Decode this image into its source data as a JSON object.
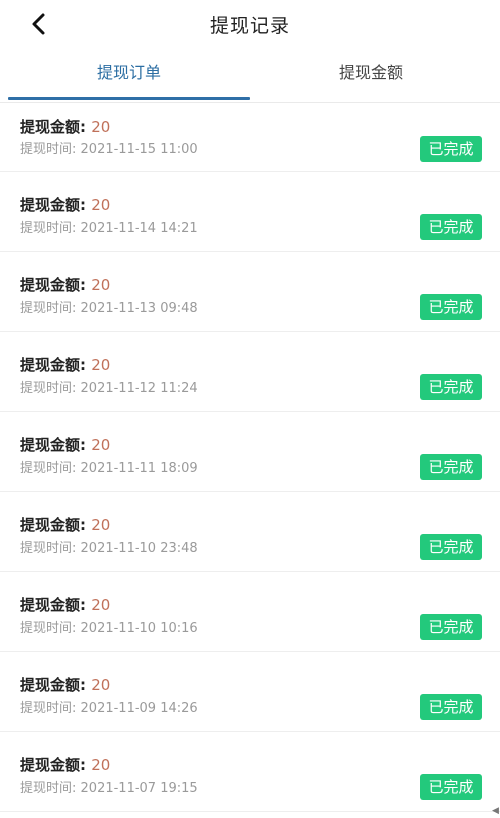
{
  "header": {
    "title": "提现记录",
    "back_icon": "chevron-left-icon"
  },
  "tabs": [
    {
      "label": "提现订单",
      "active": true
    },
    {
      "label": "提现金额",
      "active": false
    }
  ],
  "colors": {
    "accent": "#2f6fa7",
    "amount": "#c0715a",
    "badge": "#23c97c"
  },
  "records": [
    {
      "amount_label": "提现金额:",
      "amount": "20",
      "time_label": "提现时间:",
      "time": "2021-11-15 11:00",
      "status": "已完成"
    },
    {
      "amount_label": "提现金额:",
      "amount": "20",
      "time_label": "提现时间:",
      "time": "2021-11-14 14:21",
      "status": "已完成"
    },
    {
      "amount_label": "提现金额:",
      "amount": "20",
      "time_label": "提现时间:",
      "time": "2021-11-13 09:48",
      "status": "已完成"
    },
    {
      "amount_label": "提现金额:",
      "amount": "20",
      "time_label": "提现时间:",
      "time": "2021-11-12 11:24",
      "status": "已完成"
    },
    {
      "amount_label": "提现金额:",
      "amount": "20",
      "time_label": "提现时间:",
      "time": "2021-11-11 18:09",
      "status": "已完成"
    },
    {
      "amount_label": "提现金额:",
      "amount": "20",
      "time_label": "提现时间:",
      "time": "2021-11-10 23:48",
      "status": "已完成"
    },
    {
      "amount_label": "提现金额:",
      "amount": "20",
      "time_label": "提现时间:",
      "time": "2021-11-10 10:16",
      "status": "已完成"
    },
    {
      "amount_label": "提现金额:",
      "amount": "20",
      "time_label": "提现时间:",
      "time": "2021-11-09 14:26",
      "status": "已完成"
    },
    {
      "amount_label": "提现金额:",
      "amount": "20",
      "time_label": "提现时间:",
      "time": "2021-11-07 19:15",
      "status": "已完成"
    }
  ]
}
